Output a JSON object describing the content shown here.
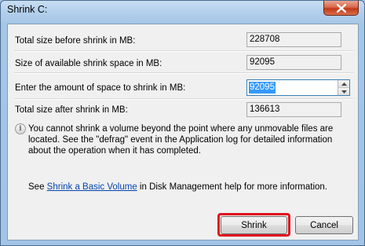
{
  "window": {
    "title": "Shrink C:"
  },
  "fields": {
    "total_size_label": "Total size before shrink in MB:",
    "total_size_value": "228708",
    "available_label": "Size of available shrink space in MB:",
    "available_value": "92095",
    "enter_label": "Enter the amount of space to shrink in MB:",
    "enter_value": "92095",
    "after_label": "Total size after shrink in MB:",
    "after_value": "136613"
  },
  "info": {
    "message": "You cannot shrink a volume beyond the point where any unmovable files are located. See the \"defrag\" event in the Application log for detailed information about the operation when it has completed."
  },
  "help": {
    "prefix": "See ",
    "link": "Shrink a Basic Volume",
    "suffix": " in Disk Management help for more information."
  },
  "buttons": {
    "shrink": "Shrink",
    "cancel": "Cancel"
  },
  "colors": {
    "highlight": "#e0141e",
    "selection": "#3399ff",
    "close_button": "#c2391a"
  }
}
